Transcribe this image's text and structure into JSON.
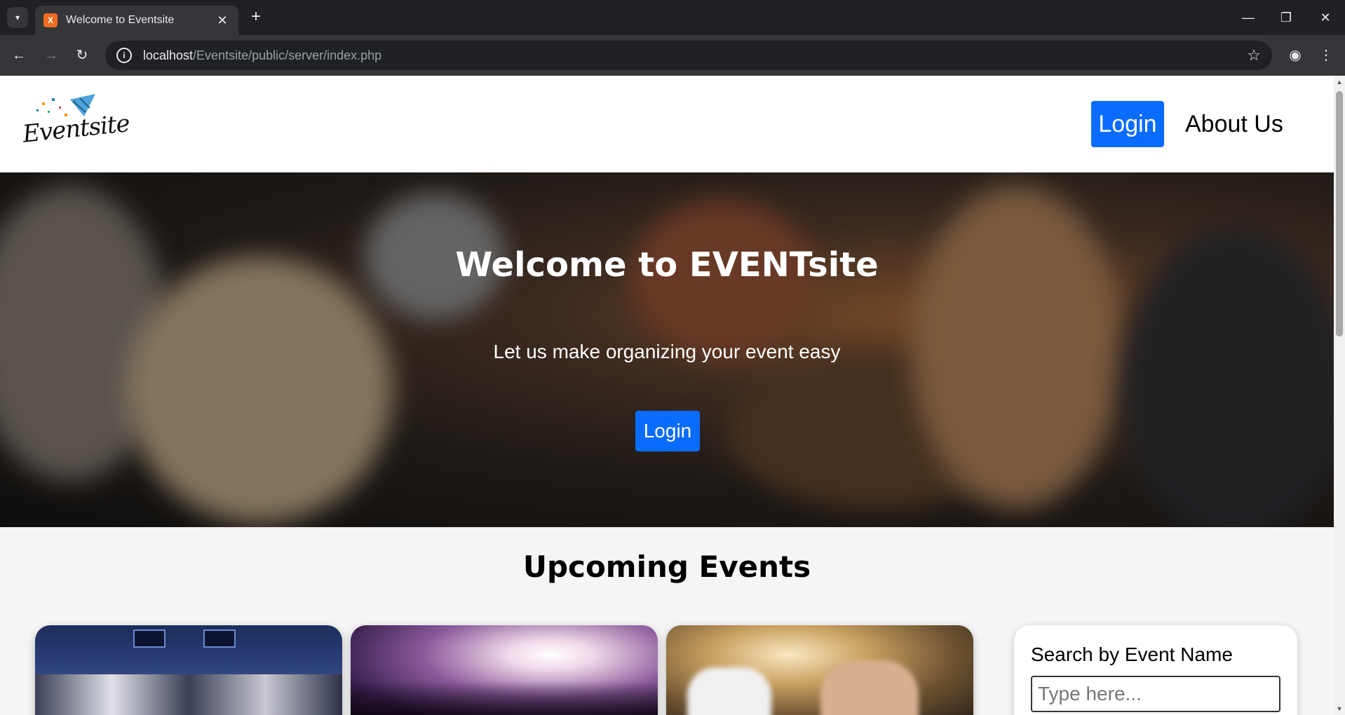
{
  "browser": {
    "tab_title": "Welcome to Eventsite",
    "url_host": "localhost",
    "url_path": "/Eventsite/public/server/index.php"
  },
  "header": {
    "logo_text": "Eventsite",
    "login_label": "Login",
    "about_label": "About Us"
  },
  "hero": {
    "title": "Welcome to EVENTsite",
    "subtitle": "Let us make organizing your event easy",
    "login_label": "Login"
  },
  "events": {
    "title": "Upcoming Events"
  },
  "search": {
    "label": "Search by Event Name",
    "placeholder": "Type here..."
  },
  "colors": {
    "primary": "#0a6cff",
    "page_bg": "#f5f5f5"
  }
}
